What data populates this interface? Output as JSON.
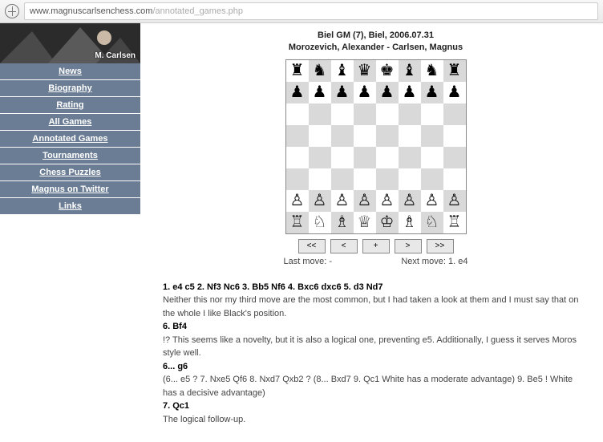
{
  "url": {
    "host": "www.magnuscarlsenchess.com",
    "path": "/annotated_games.php"
  },
  "banner": {
    "name": "M. Carlsen"
  },
  "nav": [
    "News",
    "Biography",
    "Rating",
    "All Games",
    "Annotated Games",
    "Tournaments",
    "Chess Puzzles",
    "Magnus on Twitter",
    "Links"
  ],
  "game": {
    "event": "Biel GM (7), Biel, 2006.07.31",
    "players": "Morozevich, Alexander - Carlsen, Magnus"
  },
  "board": {
    "rows": [
      [
        "♜",
        "♞",
        "♝",
        "♛",
        "♚",
        "♝",
        "♞",
        "♜"
      ],
      [
        "♟",
        "♟",
        "♟",
        "♟",
        "♟",
        "♟",
        "♟",
        "♟"
      ],
      [
        "",
        "",
        "",
        "",
        "",
        "",
        "",
        ""
      ],
      [
        "",
        "",
        "",
        "",
        "",
        "",
        "",
        ""
      ],
      [
        "",
        "",
        "",
        "",
        "",
        "",
        "",
        ""
      ],
      [
        "",
        "",
        "",
        "",
        "",
        "",
        "",
        ""
      ],
      [
        "♙",
        "♙",
        "♙",
        "♙",
        "♙",
        "♙",
        "♙",
        "♙"
      ],
      [
        "♖",
        "♘",
        "♗",
        "♕",
        "♔",
        "♗",
        "♘",
        "♖"
      ]
    ]
  },
  "controls": {
    "first": "<<",
    "prev": "<",
    "flip": "+",
    "next": ">",
    "last": ">>"
  },
  "moveinfo": {
    "last_label": "Last move:",
    "last_value": "-",
    "next_label": "Next move:",
    "next_value": "1. e4"
  },
  "annot": {
    "line1_moves": "1. e4 c5 2. Nf3 Nc6 3. Bb5 Nf6 4. Bxc6 dxc6 5. d3 Nd7",
    "line1_text": "Neither this nor my third move are the most common, but I had taken a look at them and I must say that on the whole I like Black's position.",
    "line2_moves": "6. Bf4",
    "line2_text": "!? This seems like a novelty, but it is also a logical one, preventing e5. Additionally, I guess it serves Moros style well.",
    "line3_moves": "6... g6",
    "line3_text": "(6... e5 ? 7. Nxe5 Qf6 8. Nxd7 Qxb2 ? (8... Bxd7 9. Qc1 White has a moderate advantage) 9. Be5 ! White has a decisive advantage)",
    "line4_moves": "7. Qc1",
    "line4_text": "The logical follow-up."
  }
}
